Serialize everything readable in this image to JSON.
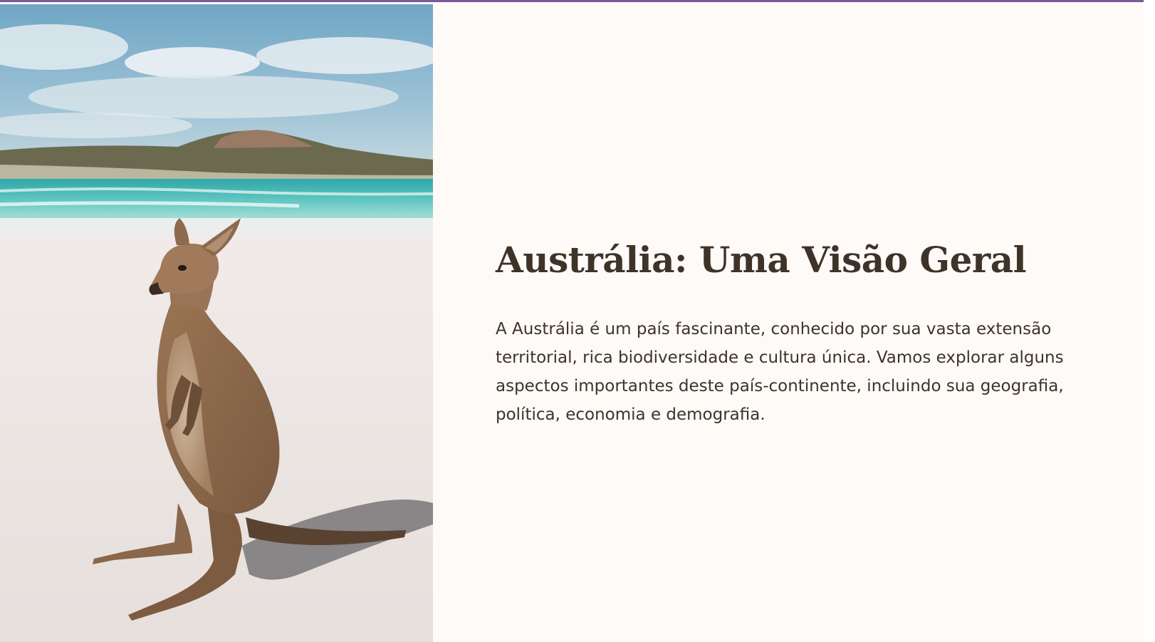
{
  "slide": {
    "title": "Austrália: Uma Visão Geral",
    "body": "A Austrália é um país fascinante, conhecido por sua vasta extensão territorial, rica biodiversidade e cultura única. Vamos explorar alguns aspectos importantes deste país-continente, incluindo sua geografia, política, economia e demografia."
  },
  "image": {
    "subject": "kangaroo-on-beach-photo"
  },
  "colors": {
    "background": "#fdfaf7",
    "text": "#3e3328",
    "top_border": "#7a5a9a"
  }
}
